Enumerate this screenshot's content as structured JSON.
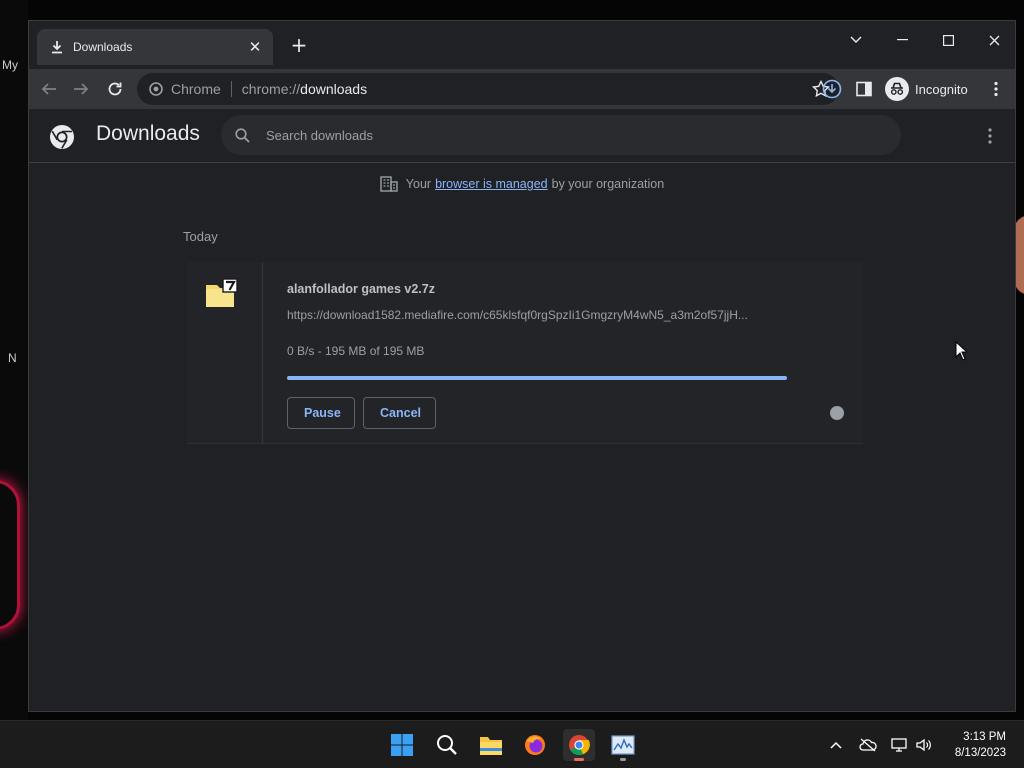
{
  "desktop": {
    "left_text_1": "My",
    "left_text_2": "N"
  },
  "tab": {
    "title": "Downloads",
    "close_glyph": "✕",
    "new_tab_glyph": "+"
  },
  "omnibox": {
    "chip": "Chrome",
    "url_scheme": "chrome://",
    "url_path": "downloads"
  },
  "profile": {
    "label": "Incognito"
  },
  "downloads_page": {
    "title": "Downloads",
    "search_placeholder": "Search downloads",
    "managed_prefix": "Your",
    "managed_link": "browser is managed",
    "managed_suffix": "by your organization",
    "section": "Today"
  },
  "download_item": {
    "file_name": "alanfollador games v2.7z",
    "url": "https://download1582.mediafire.com/c65klsfqf0rgSpzIi1GmgzryM4wN5_a3m2of57jjH...",
    "status": "0 B/s - 195 MB of 195 MB",
    "progress_fraction": 1.0,
    "pause_label": "Pause",
    "cancel_label": "Cancel"
  },
  "taskbar": {
    "time": "3:13 PM",
    "date": "8/13/2023",
    "icons": [
      "windows-start-icon",
      "search-icon",
      "file-explorer-icon",
      "firefox-icon",
      "chrome-icon",
      "task-manager-icon"
    ]
  },
  "colors": {
    "accent": "#8ab4f8",
    "background": "#202124",
    "toolbar": "#35363a"
  }
}
